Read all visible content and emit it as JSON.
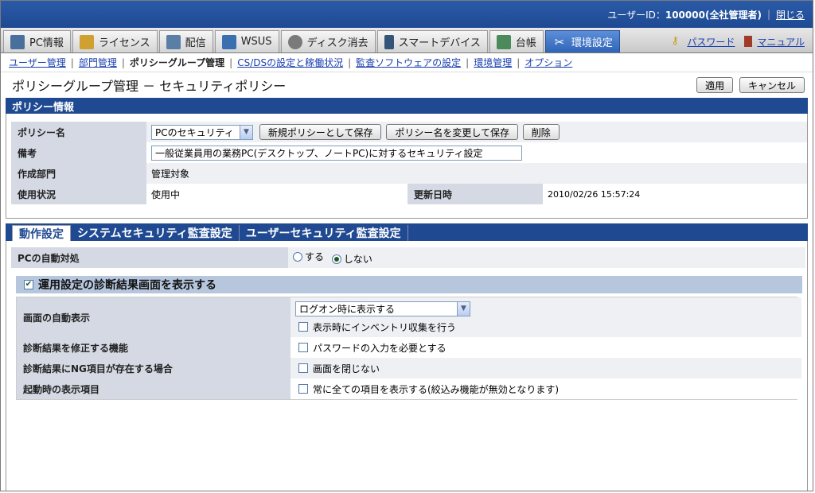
{
  "header": {
    "user_label": "ユーザーID：",
    "user_value": "100000(全社管理者)",
    "close_link": "閉じる"
  },
  "tabs": [
    {
      "label": "PC情報",
      "icon": "pc-icon",
      "color": "#4a6f9c"
    },
    {
      "label": "ライセンス",
      "icon": "license-icon",
      "color": "#d0a030"
    },
    {
      "label": "配信",
      "icon": "delivery-icon",
      "color": "#5a7ea6"
    },
    {
      "label": "WSUS",
      "icon": "wsus-icon",
      "color": "#3c6fb0"
    },
    {
      "label": "ディスク消去",
      "icon": "disk-erase-icon",
      "color": "#7a7a7a"
    },
    {
      "label": "スマートデバイス",
      "icon": "smart-device-icon",
      "color": "#335577"
    },
    {
      "label": "台帳",
      "icon": "ledger-icon",
      "color": "#4b8a5a"
    },
    {
      "label": "環境設定",
      "icon": "settings-tools-icon",
      "color": "#ffffff",
      "active": true
    }
  ],
  "top_links": {
    "password": "パスワード",
    "manual": "マニュアル"
  },
  "subnav": [
    {
      "label": "ユーザー管理",
      "link": true
    },
    {
      "label": "部門管理",
      "link": true
    },
    {
      "label": "ポリシーグループ管理",
      "link": false
    },
    {
      "label": "CS/DSの設定と稼働状況",
      "link": true
    },
    {
      "label": "監査ソフトウェアの設定",
      "link": true
    },
    {
      "label": "環境管理",
      "link": true
    },
    {
      "label": "オプション",
      "link": true
    }
  ],
  "page": {
    "title": "ポリシーグループ管理 － セキュリティポリシー",
    "apply_button": "適用",
    "cancel_button": "キャンセル"
  },
  "policy_info": {
    "section_title": "ポリシー情報",
    "name_label": "ポリシー名",
    "name_value": "PCのセキュリティ",
    "save_new_button": "新規ポリシーとして保存",
    "rename_button": "ポリシー名を変更して保存",
    "delete_button": "削除",
    "note_label": "備考",
    "note_value": "一般従業員用の業務PC(デスクトップ、ノートPC)に対するセキュリティ設定",
    "dept_label": "作成部門",
    "dept_value": "管理対象",
    "usage_label": "使用状況",
    "usage_value": "使用中",
    "updated_label": "更新日時",
    "updated_value": "2010/02/26 15:57:24"
  },
  "settings_tabs": [
    "動作設定",
    "システムセキュリティ監査設定",
    "ユーザーセキュリティ監査設定"
  ],
  "operation": {
    "auto_label": "PCの自動対処",
    "radio_yes": "する",
    "radio_no": "しない",
    "show_diag_label": "運用設定の診断結果画面を表示する",
    "auto_display_label": "画面の自動表示",
    "auto_display_value": "ログオン時に表示する",
    "inventory_check": "表示時にインベントリ収集を行う",
    "fix_func_label": "診断結果を修正する機能",
    "password_check": "パスワードの入力を必要とする",
    "ng_label": "診断結果にNG項目が存在する場合",
    "no_close_check": "画面を閉じない",
    "startup_label": "起動時の表示項目",
    "all_items_check": "常に全ての項目を表示する(絞込み機能が無効となります)"
  }
}
